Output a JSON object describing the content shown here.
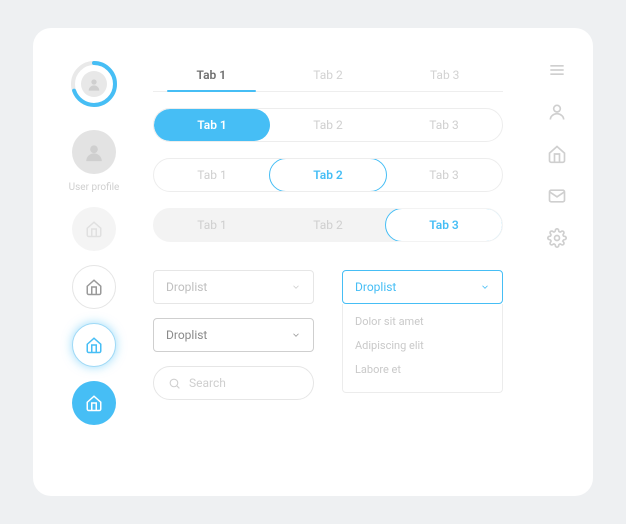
{
  "colors": {
    "accent": "#46bef5"
  },
  "left": {
    "user_profile_label": "User profile"
  },
  "tabs_line": {
    "items": [
      "Tab 1",
      "Tab 2",
      "Tab 3"
    ],
    "active": 0
  },
  "tabs_row_a": {
    "items": [
      "Tab 1",
      "Tab 2",
      "Tab 3"
    ],
    "active": 0
  },
  "tabs_row_b": {
    "items": [
      "Tab 1",
      "Tab 2",
      "Tab 3"
    ],
    "active": 1
  },
  "tabs_row_c": {
    "items": [
      "Tab 1",
      "Tab 2",
      "Tab 3"
    ],
    "active": 2
  },
  "drop": {
    "placeholder": "Droplist",
    "focus_label": "Droplist",
    "open_label": "Droplist",
    "options": [
      "Dolor sit amet",
      "Adipiscing elit",
      "Labore et"
    ]
  },
  "search": {
    "placeholder": "Search"
  },
  "rail_icons": [
    "menu",
    "user",
    "home",
    "mail",
    "settings"
  ]
}
